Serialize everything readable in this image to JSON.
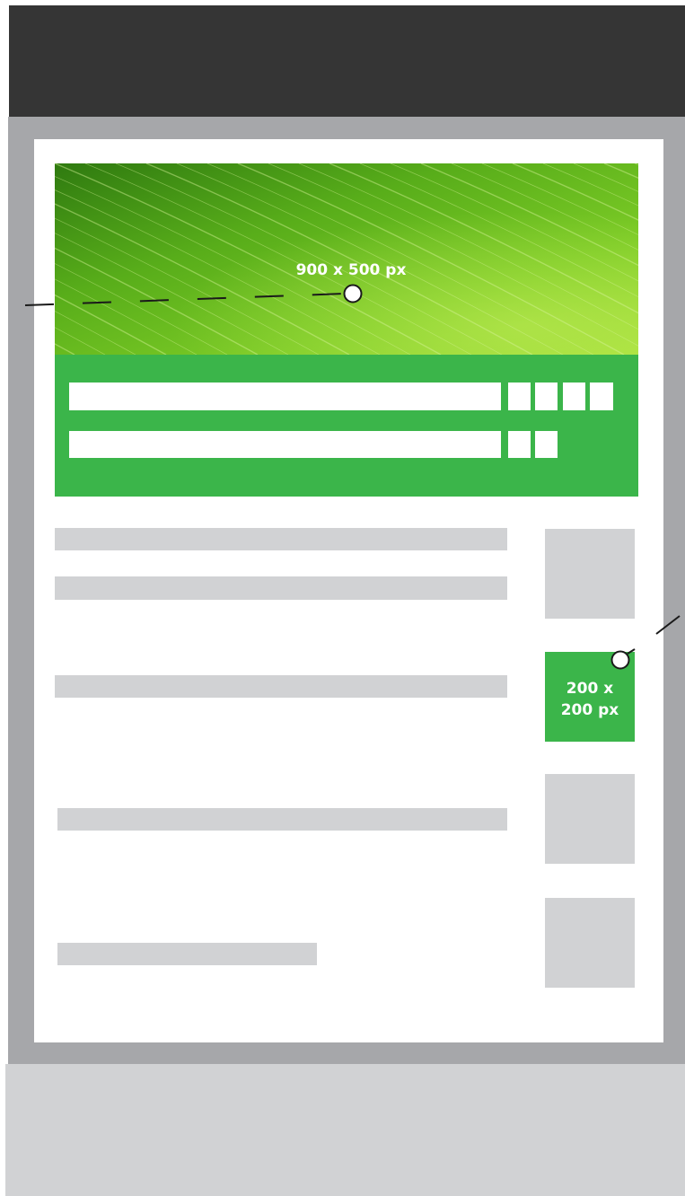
{
  "colors": {
    "top_bar": "#353535",
    "frame": "#a6a7aa",
    "page": "#ffffff",
    "footer": "#d1d2d4",
    "accent_green": "#3bb54a",
    "placeholder_gray": "#d1d2d4",
    "annotation_line": "#1a1a1a"
  },
  "hero": {
    "label": "900 x 500 px",
    "image": "green-leaf-texture"
  },
  "thumbnail": {
    "label": "200 x\n200 px"
  }
}
